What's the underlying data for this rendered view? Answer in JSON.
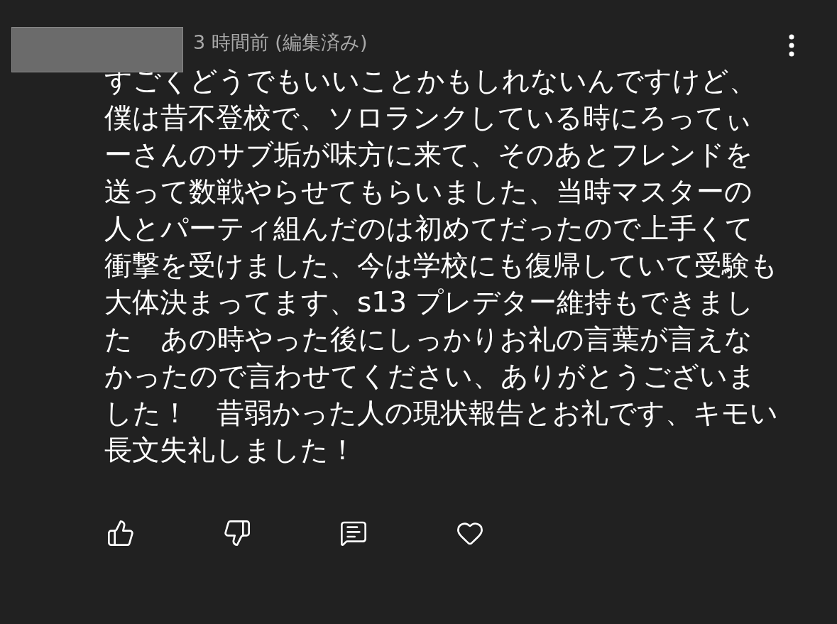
{
  "comment": {
    "timestamp": "3 時間前 (編集済み)",
    "text": "すごくどうでもいいことかもしれないんですけど、僕は昔不登校で、ソロランクしている時にろってぃーさんのサブ垢が味方に来て、そのあとフレンドを送って数戦やらせてもらいました、当時マスターの人とパーティ組んだのは初めてだったので上手くて衝撃を受けました、今は学校にも復帰していて受験も大体決まってます、s13 プレデター維持もできました　あの時やった後にしっかりお礼の言葉が言えなかったので言わせてください、ありがとうございました！　昔弱かった人の現状報告とお礼です、キモい長文失礼しました！"
  },
  "actions": [
    {
      "kind": "like"
    },
    {
      "kind": "dislike"
    },
    {
      "kind": "reply"
    },
    {
      "kind": "heart"
    }
  ]
}
